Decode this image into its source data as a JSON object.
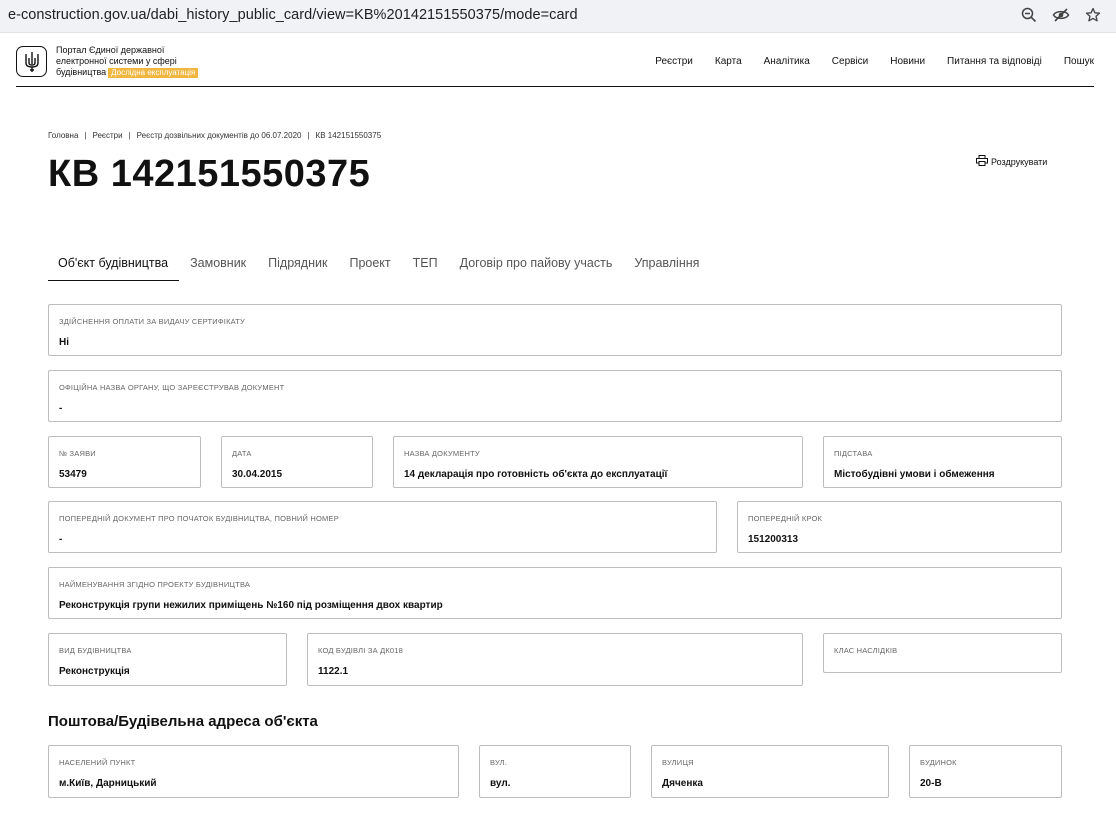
{
  "browser": {
    "url": "e-construction.gov.ua/dabi_history_public_card/view=KB%20142151550375/mode=card"
  },
  "header": {
    "logo_line1": "Портал Єдиної державної",
    "logo_line2": "електронної системи у сфері",
    "logo_line3": "будівництва",
    "beta_badge": "Дослідна експлуатація",
    "nav": [
      "Реєстри",
      "Карта",
      "Аналітика",
      "Сервіси",
      "Новини",
      "Питання та відповіді",
      "Пошук"
    ]
  },
  "breadcrumb": [
    "Головна",
    "Реєстри",
    "Реєстр дозвільних документів до 06.07.2020",
    "КВ 142151550375"
  ],
  "page_title": "КВ 142151550375",
  "print_label": "Роздрукувати",
  "tabs": [
    "Об'єкт будівництва",
    "Замовник",
    "Підрядник",
    "Проект",
    "ТЕП",
    "Договір про пайову участь",
    "Управління"
  ],
  "fields": {
    "payment": {
      "label": "Здійснення оплати за видачу сертифікату",
      "value": "Ні"
    },
    "official_name": {
      "label": "Офіційна назва органу, що зареєстрував документ",
      "value": "-"
    },
    "app_no": {
      "label": "№ заяви",
      "value": "53479"
    },
    "date": {
      "label": "Дата",
      "value": "30.04.2015"
    },
    "doc_name": {
      "label": "Назва документу",
      "value": "14 декларація про готовність об'єкта до експлуатації"
    },
    "basis": {
      "label": "Підстава",
      "value": "Містобудівні умови і обмеження"
    },
    "prev_doc": {
      "label": "Попередній документ про початок будівництва, повний номер",
      "value": "-"
    },
    "prev_step": {
      "label": "Попередній крок",
      "value": "151200313"
    },
    "project_name": {
      "label": "Найменування згідно проекту будівництва",
      "value": "Реконструкція групи нежилих приміщень №160 під розміщення двох квартир"
    },
    "construction_type": {
      "label": "Вид будівництва",
      "value": "Реконструкція"
    },
    "building_code": {
      "label": "Код будівлі за ДК018",
      "value": "1122.1"
    },
    "consequence_class": {
      "label": "Клас наслідків",
      "value": ""
    }
  },
  "address": {
    "title": "Поштова/Будівельна адреса об'єкта",
    "settlement": {
      "label": "Населений пункт",
      "value": "м.Київ, Дарницький"
    },
    "street_type": {
      "label": "Вул.",
      "value": "вул."
    },
    "street": {
      "label": "Вулиця",
      "value": "Дяченка"
    },
    "building": {
      "label": "Будинок",
      "value": "20-В"
    }
  }
}
